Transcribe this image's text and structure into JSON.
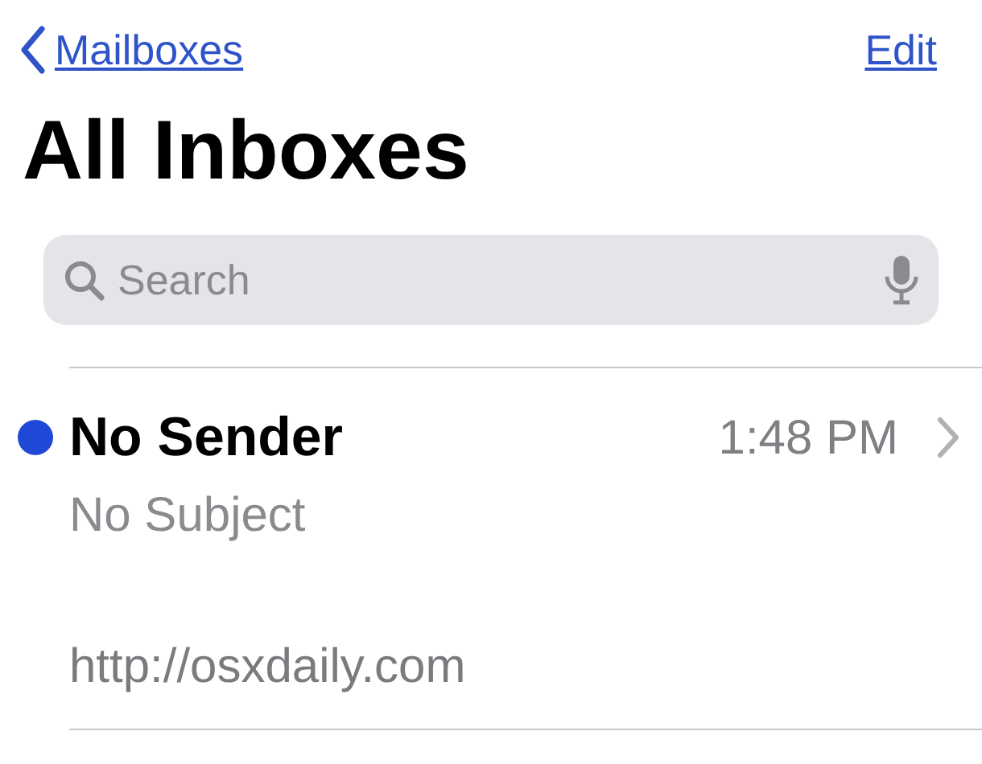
{
  "nav": {
    "back": "Mailboxes",
    "action": "Edit"
  },
  "title": "All Inboxes",
  "search": {
    "placeholder": "Search"
  },
  "messages": [
    {
      "sender": "No Sender",
      "time": "1:48 PM",
      "subject": "No Subject",
      "preview": "http://osxdaily.com",
      "unread": true
    }
  ]
}
